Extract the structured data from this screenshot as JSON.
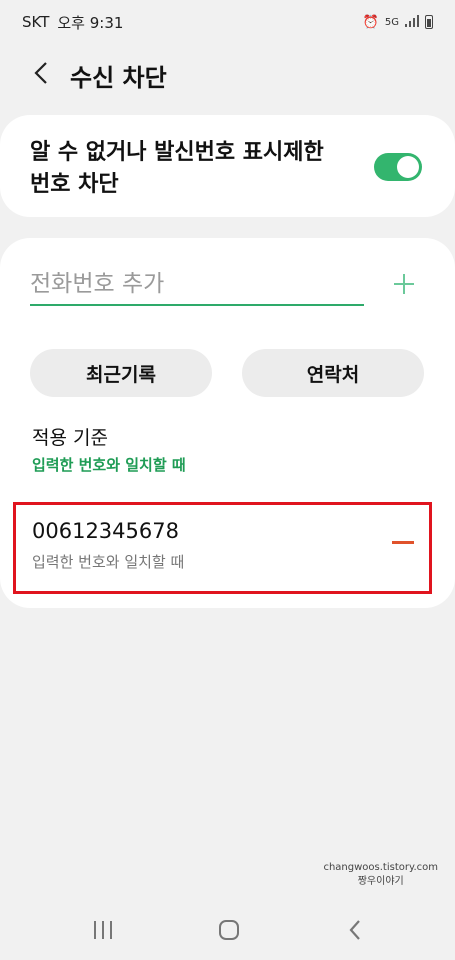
{
  "status_bar": {
    "carrier": "SKT",
    "time": "오후 9:31",
    "network": "5G"
  },
  "header": {
    "title": "수신 차단",
    "back_icon": "chevron-left-icon"
  },
  "unknown_toggle": {
    "label": "알 수 없거나 발신번호 표시제한 번호 차단",
    "enabled": true,
    "accent_color": "#33b56e"
  },
  "add_number": {
    "placeholder": "전화번호 추가",
    "value": "",
    "add_icon": "plus-icon"
  },
  "buttons": {
    "recent_label": "최근기록",
    "contacts_label": "연락처"
  },
  "criteria": {
    "title": "적용 기준",
    "value": "입력한 번호와 일치할 때",
    "color": "#1f9c55"
  },
  "blocked_list": [
    {
      "number": "00612345678",
      "rule": "입력한 번호와 일치할 때",
      "remove_icon": "minus-icon"
    }
  ],
  "watermark": {
    "line1": "changwoos.tistory.com",
    "line2": "짱우이야기"
  },
  "nav_bar": {
    "recents_icon": "recents-icon",
    "home_icon": "home-icon",
    "back_icon": "back-icon"
  },
  "highlight_color": "#e0141e"
}
